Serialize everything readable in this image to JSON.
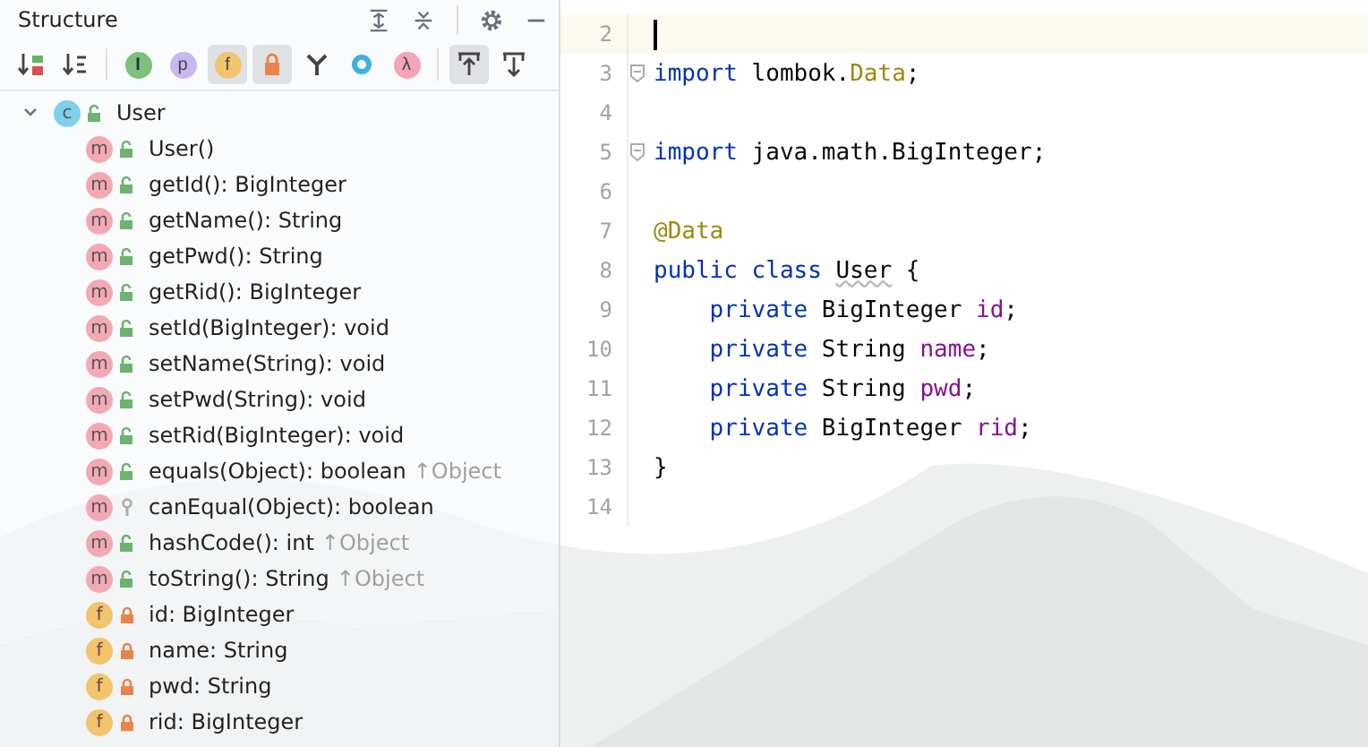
{
  "structure_panel": {
    "title": "Structure",
    "toolbar": [
      {
        "kind": "sort-visibility",
        "selected": false
      },
      {
        "kind": "sort-alpha",
        "selected": false
      },
      {
        "kind": "inherited",
        "glyph": "I",
        "selected": false
      },
      {
        "kind": "properties",
        "glyph": "p",
        "selected": false
      },
      {
        "kind": "fields",
        "glyph": "f",
        "selected": true
      },
      {
        "kind": "non-public",
        "selected": true
      },
      {
        "kind": "lombok",
        "selected": false
      },
      {
        "kind": "anonymous",
        "selected": false
      },
      {
        "kind": "lambdas",
        "glyph": "λ",
        "selected": false
      },
      {
        "kind": "scroll-from",
        "selected": true
      },
      {
        "kind": "scroll-to",
        "selected": false
      }
    ],
    "tree": {
      "label": "User",
      "glyph": "c",
      "kind": "public-class",
      "expanded": true,
      "children": [
        {
          "kind": "public-method",
          "glyph": "m",
          "label": "User()"
        },
        {
          "kind": "public-method",
          "glyph": "m",
          "label": "getId(): BigInteger"
        },
        {
          "kind": "public-method",
          "glyph": "m",
          "label": "getName(): String"
        },
        {
          "kind": "public-method",
          "glyph": "m",
          "label": "getPwd(): String"
        },
        {
          "kind": "public-method",
          "glyph": "m",
          "label": "getRid(): BigInteger"
        },
        {
          "kind": "public-method",
          "glyph": "m",
          "label": "setId(BigInteger): void"
        },
        {
          "kind": "public-method",
          "glyph": "m",
          "label": "setName(String): void"
        },
        {
          "kind": "public-method",
          "glyph": "m",
          "label": "setPwd(String): void"
        },
        {
          "kind": "public-method",
          "glyph": "m",
          "label": "setRid(BigInteger): void"
        },
        {
          "kind": "public-method",
          "glyph": "m",
          "label": "equals(Object): boolean",
          "inherited": "↑Object"
        },
        {
          "kind": "protected-method",
          "glyph": "m",
          "label": "canEqual(Object): boolean"
        },
        {
          "kind": "public-method",
          "glyph": "m",
          "label": "hashCode(): int",
          "inherited": "↑Object"
        },
        {
          "kind": "public-method",
          "glyph": "m",
          "label": "toString(): String",
          "inherited": "↑Object"
        },
        {
          "kind": "private-field",
          "glyph": "f",
          "label": "id: BigInteger"
        },
        {
          "kind": "private-field",
          "glyph": "f",
          "label": "name: String"
        },
        {
          "kind": "private-field",
          "glyph": "f",
          "label": "pwd: String"
        },
        {
          "kind": "private-field",
          "glyph": "f",
          "label": "rid: BigInteger"
        }
      ]
    }
  },
  "editor": {
    "lines": [
      {
        "number": "2",
        "current": true
      },
      {
        "number": "3",
        "fold": true,
        "tokens": [
          {
            "text": "import",
            "kind": "keyword"
          },
          {
            "text": " lombok.",
            "kind": "plain"
          },
          {
            "text": "Data",
            "kind": "annotation"
          },
          {
            "text": ";",
            "kind": "plain"
          }
        ]
      },
      {
        "number": "4"
      },
      {
        "number": "5",
        "fold": true,
        "tokens": [
          {
            "text": "import",
            "kind": "keyword"
          },
          {
            "text": " java.math.BigInteger;",
            "kind": "plain"
          }
        ]
      },
      {
        "number": "6"
      },
      {
        "number": "7",
        "tokens": [
          {
            "text": "@Data",
            "kind": "annotation"
          }
        ]
      },
      {
        "number": "8",
        "tokens": [
          {
            "text": "public class ",
            "kind": "keyword"
          },
          {
            "text": "User",
            "kind": "warn"
          },
          {
            "text": " {",
            "kind": "plain"
          }
        ]
      },
      {
        "number": "9",
        "tokens": [
          {
            "text": "    private",
            "kind": "keyword"
          },
          {
            "text": " BigInteger ",
            "kind": "plain"
          },
          {
            "text": "id",
            "kind": "field"
          },
          {
            "text": ";",
            "kind": "plain"
          }
        ]
      },
      {
        "number": "10",
        "tokens": [
          {
            "text": "    private",
            "kind": "keyword"
          },
          {
            "text": " String ",
            "kind": "plain"
          },
          {
            "text": "name",
            "kind": "field"
          },
          {
            "text": ";",
            "kind": "plain"
          }
        ]
      },
      {
        "number": "11",
        "tokens": [
          {
            "text": "    private",
            "kind": "keyword"
          },
          {
            "text": " String ",
            "kind": "plain"
          },
          {
            "text": "pwd",
            "kind": "field"
          },
          {
            "text": ";",
            "kind": "plain"
          }
        ]
      },
      {
        "number": "12",
        "tokens": [
          {
            "text": "    private",
            "kind": "keyword"
          },
          {
            "text": " BigInteger ",
            "kind": "plain"
          },
          {
            "text": "rid",
            "kind": "field"
          },
          {
            "text": ";",
            "kind": "plain"
          }
        ]
      },
      {
        "number": "13",
        "tokens": [
          {
            "text": "}",
            "kind": "plain"
          }
        ]
      },
      {
        "number": "14"
      }
    ]
  }
}
